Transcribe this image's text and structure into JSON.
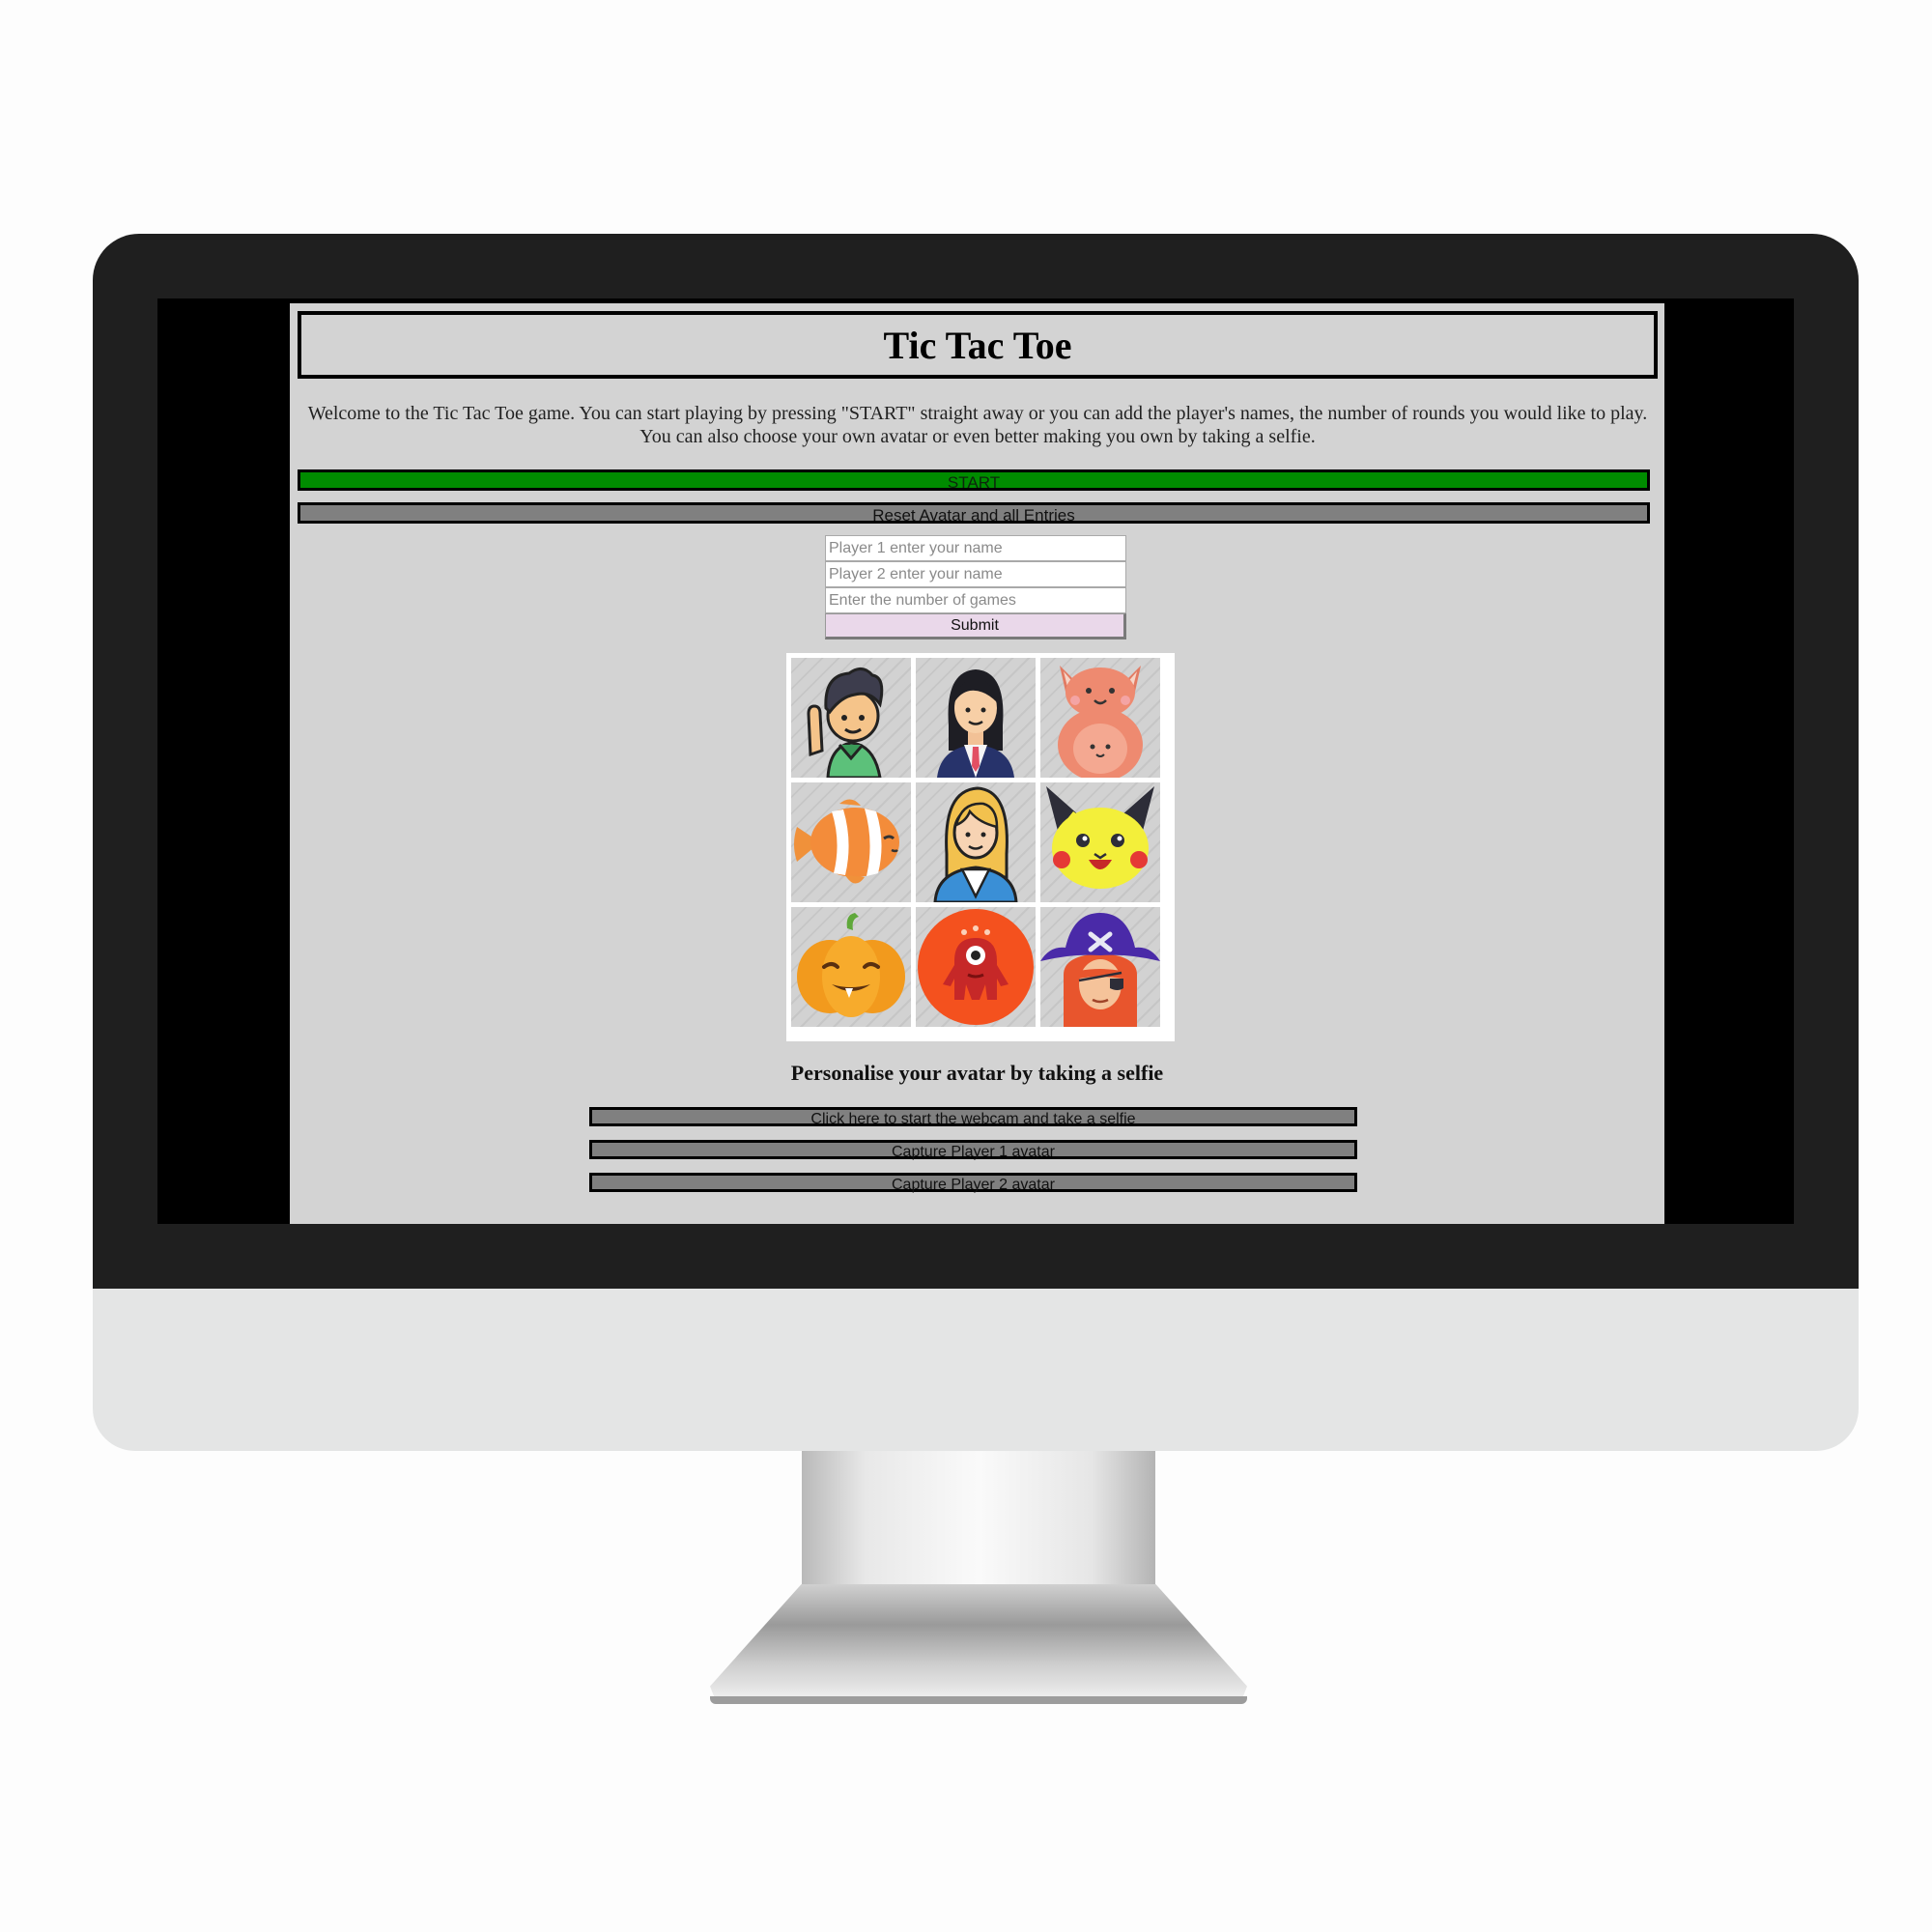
{
  "page": {
    "title": "Tic Tac Toe",
    "intro": "Welcome to the Tic Tac Toe game. You can start playing by pressing \"START\" straight away or you can add the player's names, the number of rounds you would like to play. You can also choose your own avatar or even better making you own by taking a selfie."
  },
  "controls": {
    "start_label": "START",
    "reset_label": "Reset Avatar and all Entries"
  },
  "form": {
    "player1_placeholder": "Player 1 enter your name",
    "player2_placeholder": "Player 2 enter your name",
    "games_placeholder": "Enter the number of games",
    "player1_value": "",
    "player2_value": "",
    "games_value": "",
    "submit_label": "Submit"
  },
  "avatars": [
    {
      "icon": "boy-waving-icon"
    },
    {
      "icon": "businesswoman-icon"
    },
    {
      "icon": "kangaroo-icon"
    },
    {
      "icon": "clownfish-icon"
    },
    {
      "icon": "blonde-woman-icon"
    },
    {
      "icon": "pikachu-icon"
    },
    {
      "icon": "pumpkin-icon"
    },
    {
      "icon": "red-monster-icon"
    },
    {
      "icon": "pirate-girl-icon"
    }
  ],
  "selfie": {
    "heading": "Personalise your avatar by taking a selfie",
    "webcam_label": "Click here to start the webcam and take a selfie",
    "capture1_label": "Capture Player 1 avatar",
    "capture2_label": "Capture Player 2 avatar"
  },
  "colors": {
    "start": "#008c00",
    "gray_button": "#808080",
    "page_bg": "#d3d3d3",
    "submit_bg": "#ead8ea"
  }
}
